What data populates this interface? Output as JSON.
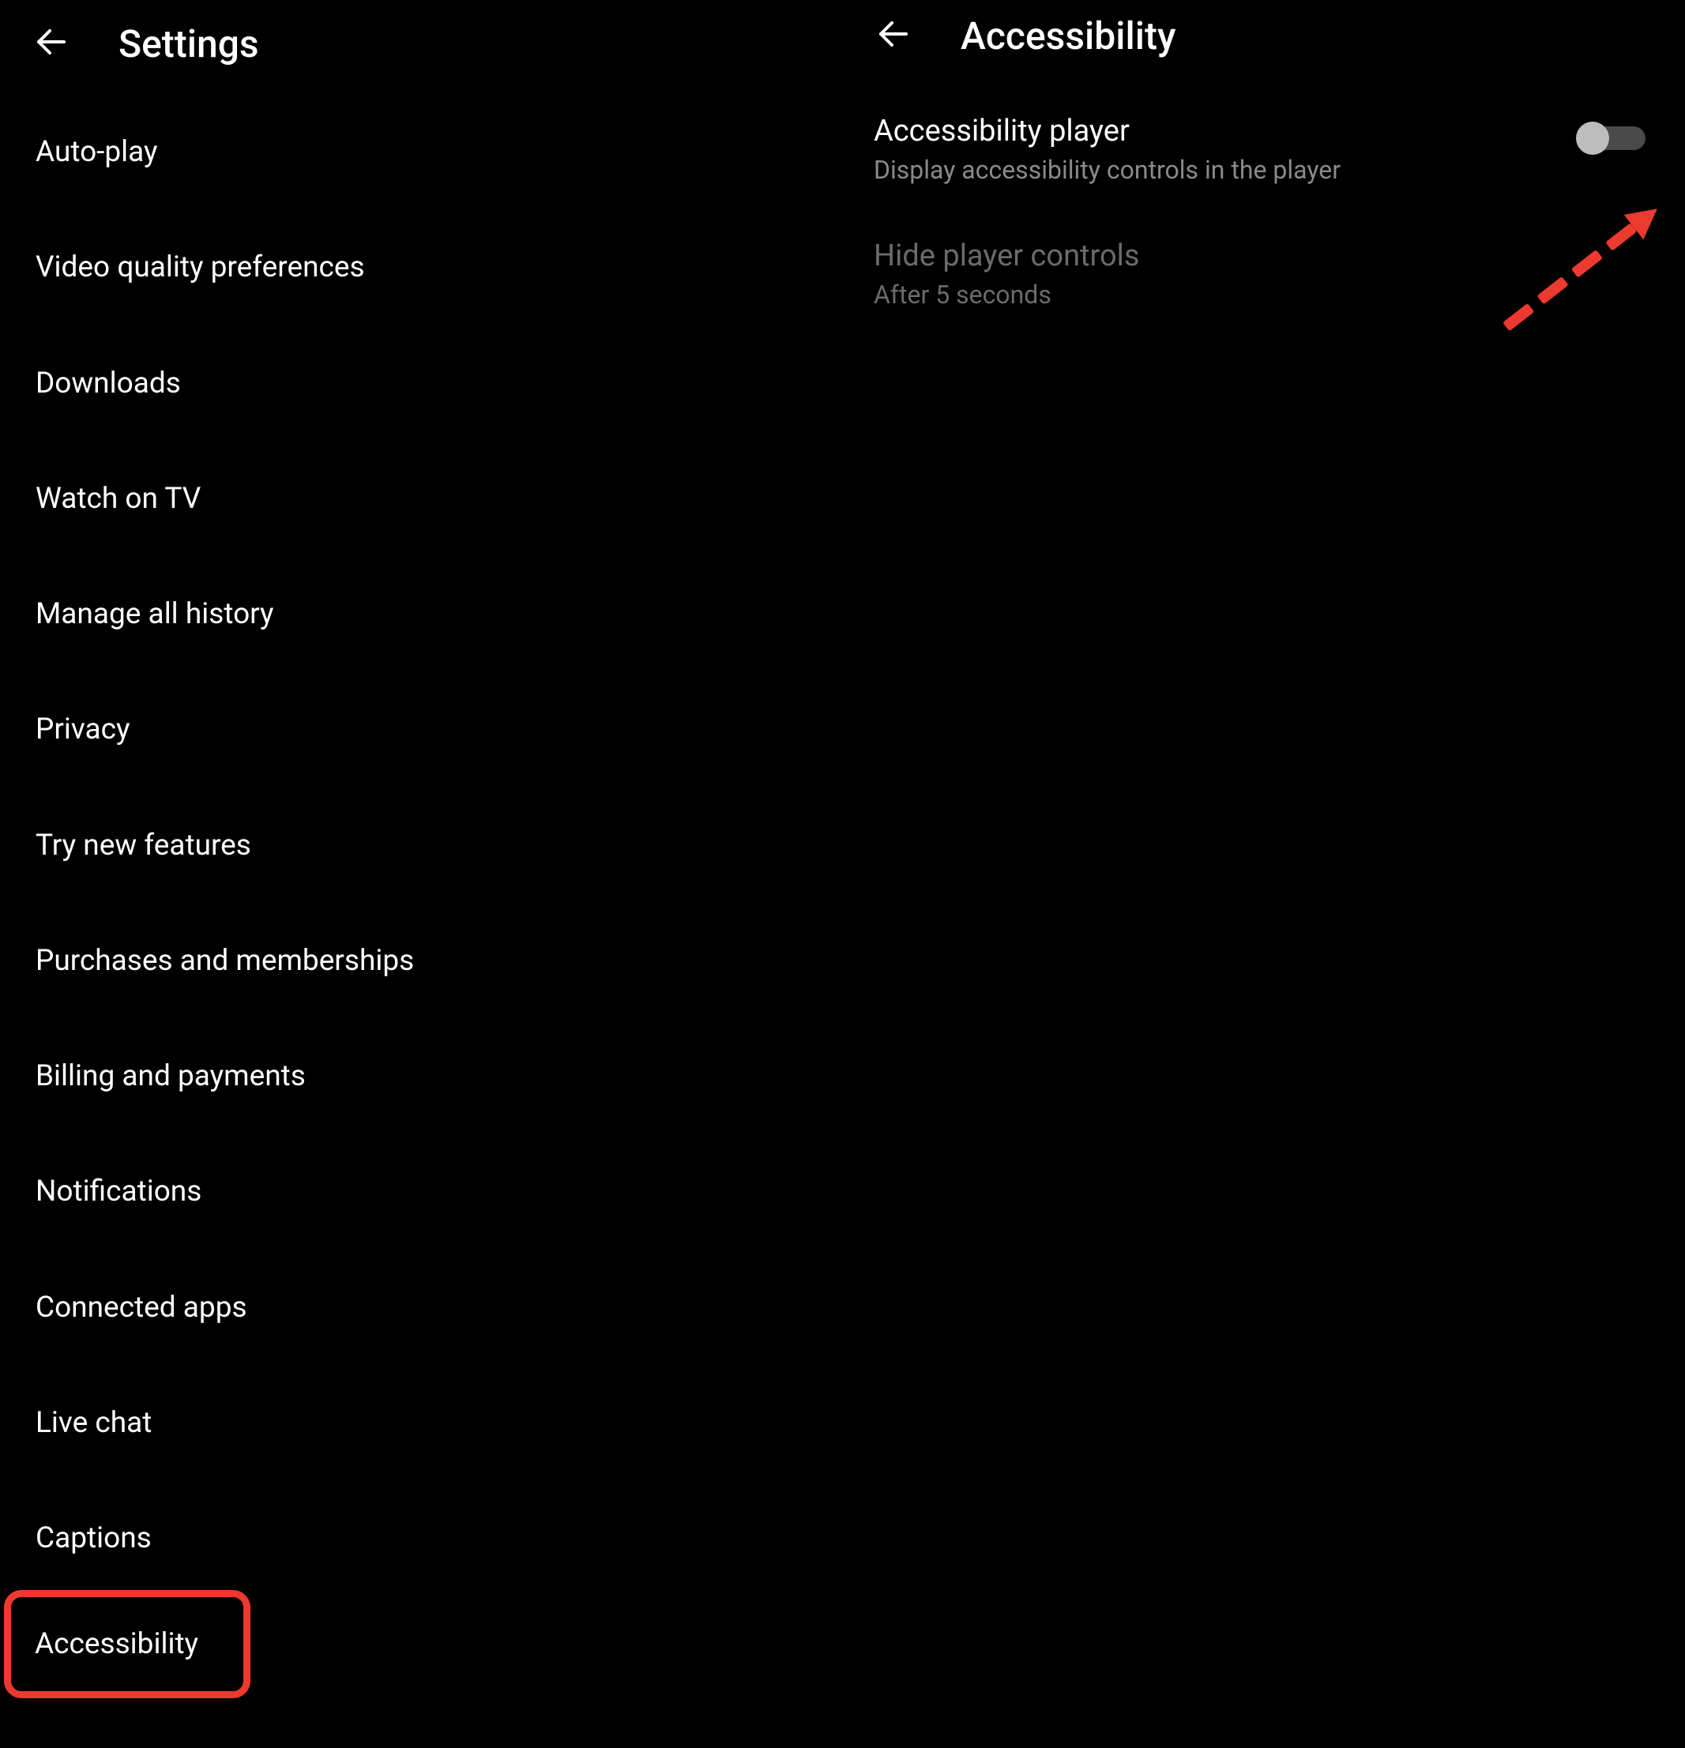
{
  "left": {
    "title": "Settings",
    "items": [
      "Auto-play",
      "Video quality preferences",
      "Downloads",
      "Watch on TV",
      "Manage all history",
      "Privacy",
      "Try new features",
      "Purchases and memberships",
      "Billing and payments",
      "Notifications",
      "Connected apps",
      "Live chat",
      "Captions",
      "Accessibility"
    ],
    "highlighted_index": 13
  },
  "right": {
    "title": "Accessibility",
    "rows": [
      {
        "title": "Accessibility player",
        "sub": "Display accessibility controls in the player",
        "toggle": false,
        "enabled": true
      },
      {
        "title": "Hide player controls",
        "sub": "After 5 seconds",
        "enabled": false
      }
    ]
  },
  "annotation": {
    "highlight_color": "#ED3A31",
    "arrow_color": "#ED3A31"
  }
}
